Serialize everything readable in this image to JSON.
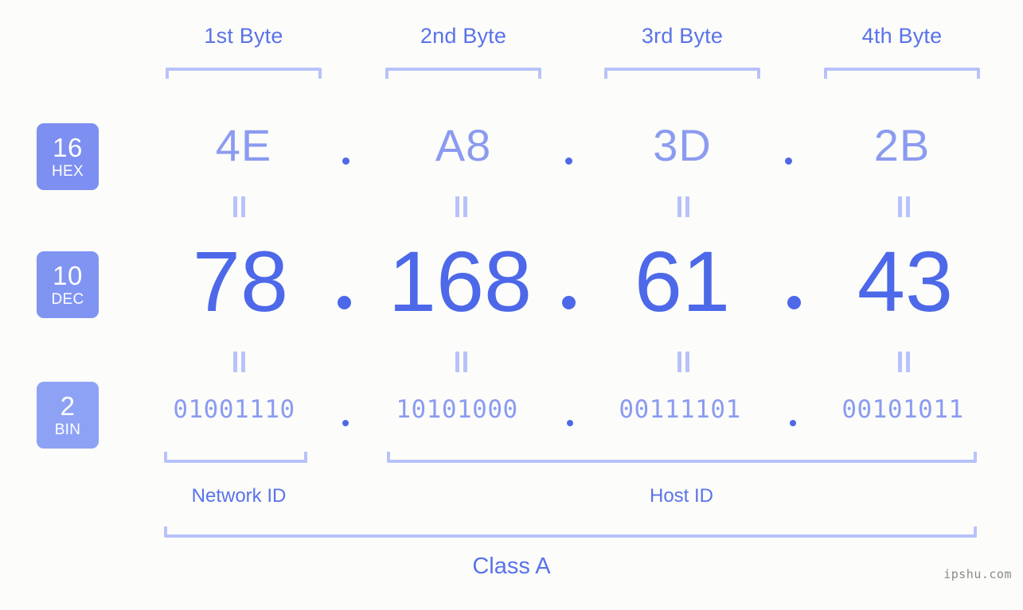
{
  "background_color": "#fcfdfa",
  "colors": {
    "bracket": "#b8c2fa",
    "hex_text": "#8b9bf0",
    "dec_text": "#4d68e8",
    "header_text": "#5a72ea",
    "badge_hex_bg": "#7d8ff0",
    "badge_dec_bg": "#8094f2",
    "badge_bin_bg": "#8ea2f5",
    "badge_text": "#ffffff",
    "watermark": "#8a8a8a"
  },
  "byte_headers": [
    {
      "label": "1st Byte"
    },
    {
      "label": "2nd Byte"
    },
    {
      "label": "3rd Byte"
    },
    {
      "label": "4th Byte"
    }
  ],
  "rows": {
    "hex": {
      "badge_number": "16",
      "badge_name": "HEX",
      "values": [
        "4E",
        "A8",
        "3D",
        "2B"
      ],
      "separator": "."
    },
    "dec": {
      "badge_number": "10",
      "badge_name": "DEC",
      "values": [
        "78",
        "168",
        "61",
        "43"
      ],
      "separator": "."
    },
    "bin": {
      "badge_number": "2",
      "badge_name": "BIN",
      "values": [
        "01001110",
        "10101000",
        "00111101",
        "00101011"
      ],
      "separator": "."
    }
  },
  "equals_symbol": "=",
  "partitions": [
    {
      "label": "Network ID"
    },
    {
      "label": "Host ID"
    }
  ],
  "class": {
    "label": "Class A"
  },
  "watermark": {
    "text": "ipshu.com"
  }
}
